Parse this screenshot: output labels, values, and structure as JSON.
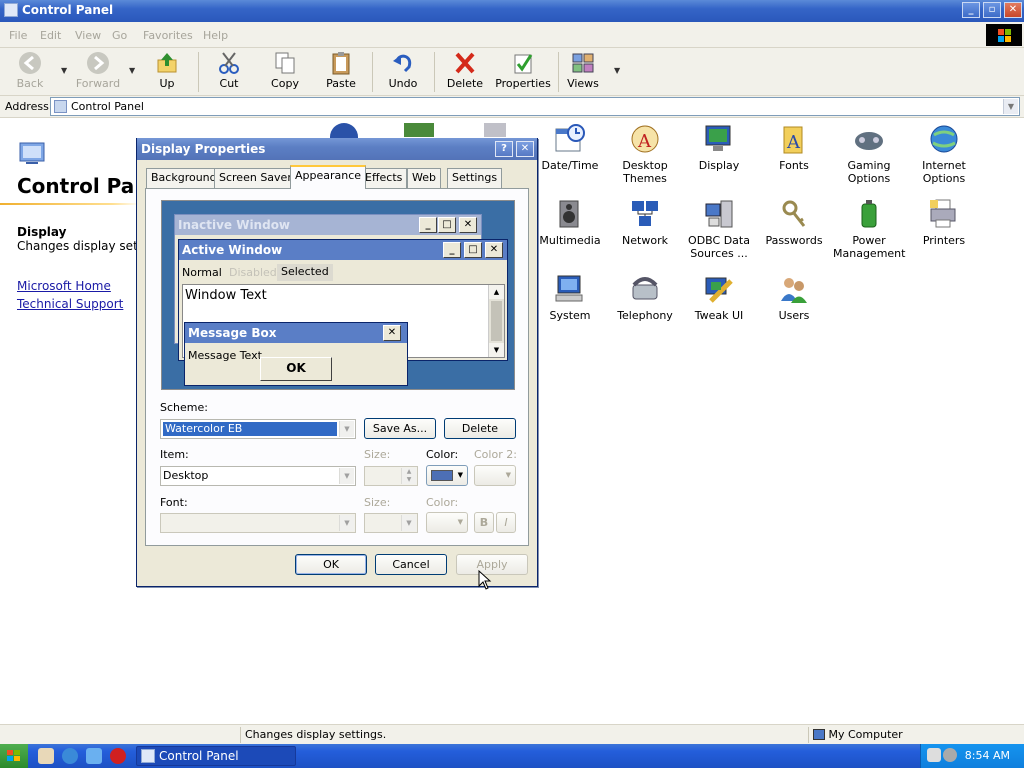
{
  "window": {
    "title": "Control Panel"
  },
  "menu": [
    "File",
    "Edit",
    "View",
    "Go",
    "Favorites",
    "Help"
  ],
  "toolbar": {
    "back": "Back",
    "forward": "Forward",
    "up": "Up",
    "cut": "Cut",
    "copy": "Copy",
    "paste": "Paste",
    "undo": "Undo",
    "delete": "Delete",
    "properties": "Properties",
    "views": "Views"
  },
  "address": {
    "label": "Address",
    "value": "Control Panel"
  },
  "leftpane": {
    "title": "Control Pa",
    "selected_name": "Display",
    "selected_desc": "Changes display sett",
    "links": [
      "Microsoft Home",
      "Technical Support"
    ]
  },
  "icons": [
    {
      "label": "Date/Time",
      "icon": "clock-calendar-icon"
    },
    {
      "label": "Desktop Themes",
      "icon": "themes-icon"
    },
    {
      "label": "Display",
      "icon": "monitor-icon"
    },
    {
      "label": "Fonts",
      "icon": "fonts-folder-icon"
    },
    {
      "label": "Gaming Options",
      "icon": "gamepad-icon"
    },
    {
      "label": "Internet Options",
      "icon": "globe-icon"
    },
    {
      "label": "Multimedia",
      "icon": "speaker-icon"
    },
    {
      "label": "Network",
      "icon": "network-icon"
    },
    {
      "label": "ODBC Data Sources ...",
      "icon": "database-icon"
    },
    {
      "label": "Passwords",
      "icon": "keys-icon"
    },
    {
      "label": "Power Management",
      "icon": "battery-icon"
    },
    {
      "label": "Printers",
      "icon": "printer-icon"
    },
    {
      "label": "System",
      "icon": "computer-icon"
    },
    {
      "label": "Telephony",
      "icon": "telephone-icon"
    },
    {
      "label": "Tweak UI",
      "icon": "tweak-icon"
    },
    {
      "label": "Users",
      "icon": "users-icon"
    }
  ],
  "status": {
    "text": "Changes display settings.",
    "zone": "My Computer"
  },
  "taskbar": {
    "task": "Control Panel",
    "clock": "8:54 AM"
  },
  "dialog": {
    "title": "Display Properties",
    "tabs": [
      "Background",
      "Screen Saver",
      "Appearance",
      "Effects",
      "Web",
      "Settings"
    ],
    "active_tab": "Appearance",
    "preview": {
      "inactive": "Inactive Window",
      "active": "Active Window",
      "menu_normal": "Normal",
      "menu_disabled": "Disabled",
      "menu_selected": "Selected",
      "window_text": "Window Text",
      "msgbox_title": "Message Box",
      "msgbox_text": "Message Text",
      "msgbox_ok": "OK"
    },
    "scheme_label": "Scheme:",
    "scheme_value": "Watercolor EB",
    "save_as": "Save As...",
    "delete": "Delete",
    "item_label": "Item:",
    "item_value": "Desktop",
    "size_label": "Size:",
    "color_label": "Color:",
    "color2_label": "Color 2:",
    "font_label": "Font:",
    "font_size_label": "Size:",
    "font_color_label": "Color:",
    "bold": "B",
    "italic": "I",
    "ok": "OK",
    "cancel": "Cancel",
    "apply": "Apply"
  },
  "colors": {
    "active_title": "#0a246a",
    "inactive_title": "#a6b4d4",
    "desktop": "#3a6ea5",
    "selected": "#316ac5",
    "desktop_color_swatch": "#4d6fb5"
  }
}
